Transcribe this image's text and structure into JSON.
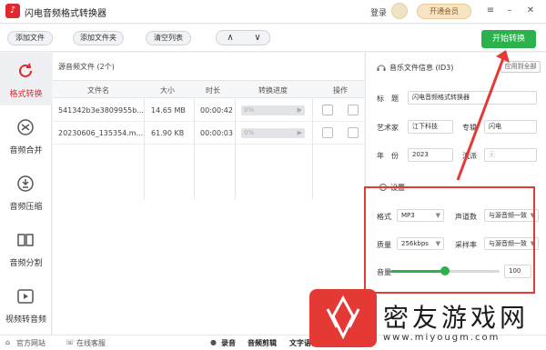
{
  "app": {
    "title": "闪电音频格式转换器",
    "logo_glyph": "♪",
    "login": "登录",
    "vip": "开通会员",
    "window_controls": {
      "menu": "≡",
      "minimize": "–",
      "close": "✕"
    }
  },
  "toolbar": {
    "add_file": "添加文件",
    "add_folder": "添加文件夹",
    "clear_list": "清空列表",
    "move_up": "∧",
    "move_down": "∨",
    "start": "开始转换"
  },
  "sidebar": {
    "items": [
      {
        "label": "格式转换",
        "icon": "refresh-icon",
        "active": true
      },
      {
        "label": "音频合并",
        "icon": "merge-icon",
        "active": false
      },
      {
        "label": "音频压缩",
        "icon": "compress-icon",
        "active": false
      },
      {
        "label": "音频分割",
        "icon": "split-icon",
        "active": false
      },
      {
        "label": "视频转音频",
        "icon": "video-icon",
        "active": false
      }
    ]
  },
  "file_panel": {
    "title": "源音频文件 (2个)",
    "headers": {
      "name": "文件名",
      "size": "大小",
      "duration": "时长",
      "progress": "转换进度",
      "action": "操作"
    },
    "rows": [
      {
        "name": "541342b3e3809955b...",
        "size": "14.65 MB",
        "duration": "00:00:42",
        "progress": "0%"
      },
      {
        "name": "20230606_135354.m...",
        "size": "61.90 KB",
        "duration": "00:00:03",
        "progress": "0%"
      }
    ]
  },
  "id3": {
    "title": "音乐文件信息 (ID3)",
    "apply_all": "应用到全部",
    "title_label": "标　题",
    "title_value": "闪电音频格式转换器",
    "artist_label": "艺术家",
    "artist_value": "江下科技",
    "album_label": "专辑",
    "album_value": "闪电",
    "year_label": "年　份",
    "year_value": "2023",
    "genre_label": "流派",
    "genre_placeholder": "无"
  },
  "settings": {
    "title": "设置",
    "format_label": "格式",
    "format_value": "MP3",
    "channels_label": "声道数",
    "channels_value": "与源音频一致",
    "quality_label": "质量",
    "quality_value": "256kbps",
    "samplerate_label": "采样率",
    "samplerate_value": "与源音频一致",
    "volume_label": "音量",
    "volume_value": "100",
    "volume_fraction": 0.5
  },
  "statusbar": {
    "website": "官方网站",
    "support": "在线客服",
    "record": "录音",
    "edit": "音频剪辑",
    "tts": "文字语音"
  },
  "watermark": {
    "text": "密友游戏网",
    "url": "www.miyougm.com"
  },
  "colors": {
    "accent_green": "#2bb24c",
    "brand_red": "#e0292f",
    "annotation_red": "#e53935"
  }
}
